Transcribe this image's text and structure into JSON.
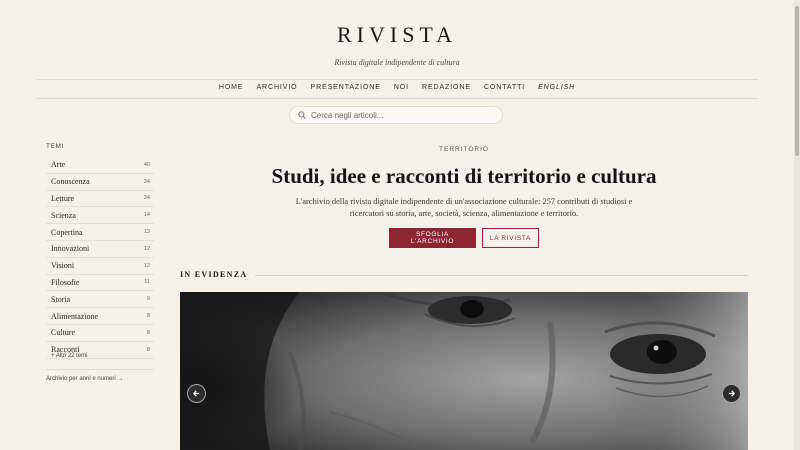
{
  "header": {
    "brand": "RIVISTA",
    "tagline": "Rivista digitale indipendente di cultura"
  },
  "nav": {
    "items": [
      "HOME",
      "ARCHIVIO",
      "PRESENTAZIONE",
      "NOI",
      "REDAZIONE",
      "CONTATTI",
      "ENGLISH"
    ]
  },
  "search": {
    "placeholder": "Cerca negli articoli...",
    "value": ""
  },
  "sidebar": {
    "heading": "TEMI",
    "themes": [
      {
        "label": "Arte",
        "count": "40"
      },
      {
        "label": "Conoscenza",
        "count": "34"
      },
      {
        "label": "Letture",
        "count": "34"
      },
      {
        "label": "Scienza",
        "count": "14"
      },
      {
        "label": "Copertina",
        "count": "13"
      },
      {
        "label": "Innovazioni",
        "count": "12"
      },
      {
        "label": "Visioni",
        "count": "12"
      },
      {
        "label": "Filosofie",
        "count": "11"
      },
      {
        "label": "Storia",
        "count": "9"
      },
      {
        "label": "Alimentazione",
        "count": "8"
      },
      {
        "label": "Culture",
        "count": "8"
      },
      {
        "label": "Racconti",
        "count": "8"
      }
    ],
    "more": "+ Altri 22 temi",
    "archive_link": "Archivio per anni e numeri →"
  },
  "hero": {
    "kicker": "TERRITORIO",
    "title": "Studi, idee e racconti di territorio e cultura",
    "description": "L'archivio della rivista digitale indipendente di un'associazione culturale: 257 contributi di studiosi e ricercatori su storia, arte, società, scienza, alimentazione e territorio.",
    "primary_button": "SFOGLIA L'ARCHIVIO",
    "secondary_button": "LA RIVISTA"
  },
  "featured": {
    "section_title": "IN EVIDENZA"
  },
  "icons": {
    "search": "search-icon",
    "prev": "arrow-left-icon",
    "next": "arrow-right-icon"
  },
  "colors": {
    "background": "#f6f2ea",
    "accent": "#8e2535"
  }
}
